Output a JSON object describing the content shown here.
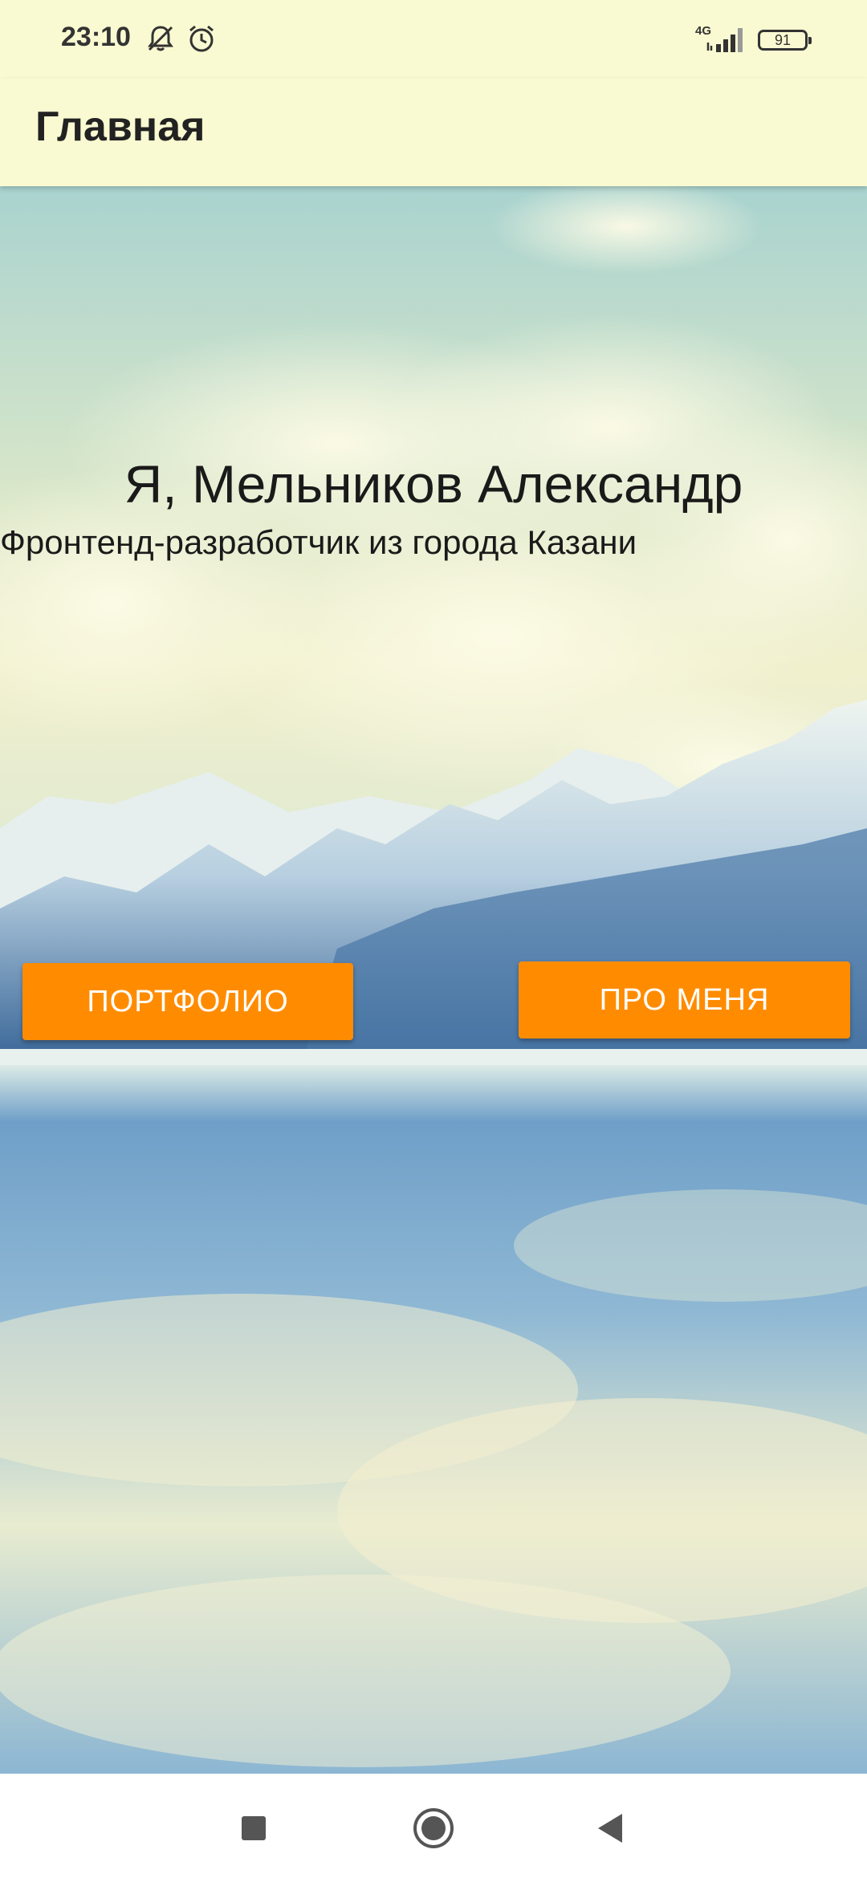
{
  "status_bar": {
    "time": "23:10",
    "network": "4G",
    "battery": "91",
    "icons": [
      "notifications-off-icon",
      "alarm-icon",
      "signal-icon",
      "battery-icon"
    ]
  },
  "app_bar": {
    "title": "Главная",
    "background_color": "#fafad2"
  },
  "hero": {
    "title": "Я, Мельников Александр",
    "subtitle": "Фронтенд-разработчик из города Казани"
  },
  "buttons": {
    "portfolio_label": "ПОРТФОЛИО",
    "about_label": "ПРО МЕНЯ",
    "color": "#ff8c00"
  },
  "nav_bar": {
    "icons": [
      "recents-icon",
      "home-icon",
      "back-icon"
    ]
  }
}
